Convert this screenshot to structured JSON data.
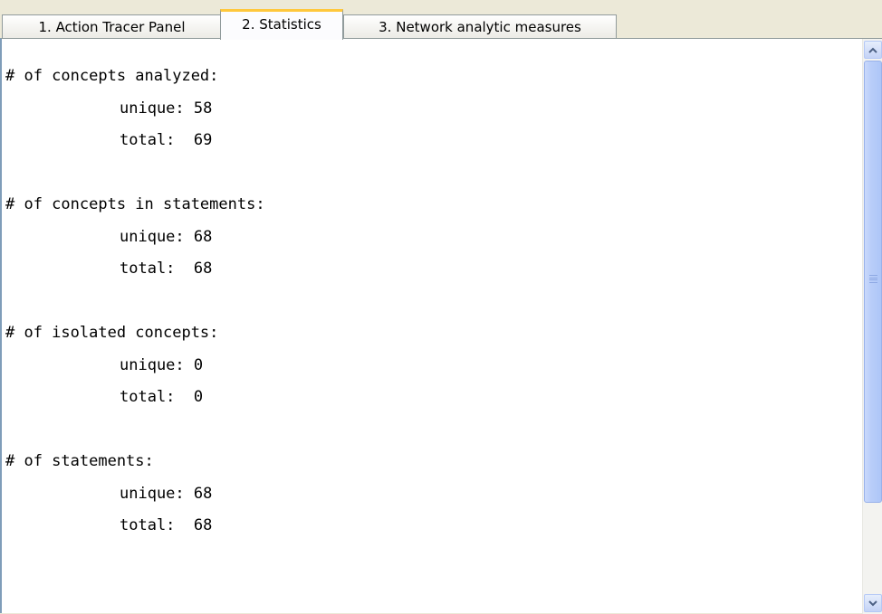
{
  "tabs": [
    {
      "label": "1. Action Tracer Panel"
    },
    {
      "label": "2. Statistics"
    },
    {
      "label": "3. Network analytic measures"
    }
  ],
  "statistics": {
    "sections": [
      {
        "heading": "# of concepts analyzed:",
        "unique": "unique: 58",
        "total": "total:  69"
      },
      {
        "heading": "# of concepts in statements:",
        "unique": "unique: 68",
        "total": "total:  68"
      },
      {
        "heading": "# of isolated concepts:",
        "unique": "unique: 0",
        "total": "total:  0"
      },
      {
        "heading": "# of statements:",
        "unique": "unique: 68",
        "total": "total:  68"
      }
    ]
  },
  "icons": {
    "scroll_up": "chevron-up-icon",
    "scroll_down": "chevron-down-icon"
  },
  "colors": {
    "active_tab_accent": "#ffc83c",
    "scroll_thumb": "#b8cdf9"
  }
}
